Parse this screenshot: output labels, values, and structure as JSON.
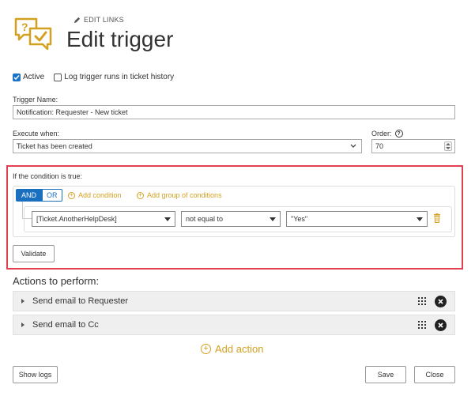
{
  "header": {
    "edit_links": "EDIT LINKS",
    "title": "Edit trigger",
    "accent": "#d4a020"
  },
  "options": {
    "active_label": "Active",
    "active_checked": true,
    "log_label": "Log trigger runs in ticket history",
    "log_checked": false
  },
  "trigger_name": {
    "label": "Trigger Name:",
    "value": "Notification: Requester - New ticket"
  },
  "execute_when": {
    "label": "Execute when:",
    "value": "Ticket has been created"
  },
  "order": {
    "label": "Order:",
    "value": "70"
  },
  "condition": {
    "title": "If the condition is true:",
    "and_label": "AND",
    "or_label": "OR",
    "add_condition": "Add condition",
    "add_group": "Add group of conditions",
    "field": "[Ticket.AnotherHelpDesk]",
    "operator": "not equal to",
    "value": "\"Yes\"",
    "validate": "Validate"
  },
  "actions": {
    "title": "Actions to perform:",
    "items": [
      {
        "label": "Send email to Requester"
      },
      {
        "label": "Send email to Cc"
      }
    ],
    "add_action": "Add action"
  },
  "footer": {
    "show_logs": "Show logs",
    "save": "Save",
    "close": "Close"
  }
}
